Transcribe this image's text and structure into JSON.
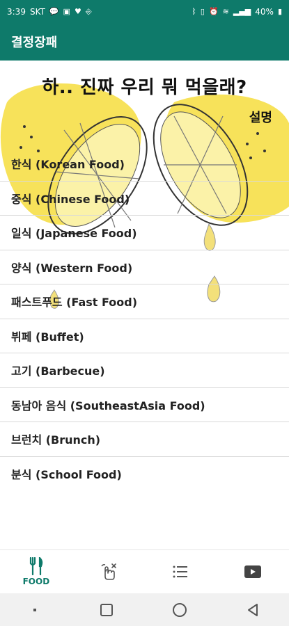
{
  "status_bar": {
    "time": "3:39",
    "carrier": "SKT",
    "battery": "40%",
    "icons": [
      "chat-icon",
      "gallery-icon",
      "heart-icon",
      "usb-icon",
      "bluetooth-icon",
      "vibrate-icon",
      "alarm-icon",
      "wifi-icon",
      "signal-icon",
      "battery-icon"
    ]
  },
  "app_bar": {
    "title": "결정장패"
  },
  "main": {
    "headline": "하.. 진짜 우리 뭐 먹을래?",
    "description_link": "설명",
    "food_categories": [
      "한식 (Korean Food)",
      "중식 (Chinese Food)",
      "일식 (Japanese Food)",
      "양식 (Western Food)",
      "패스트푸드 (Fast Food)",
      "뷔페 (Buffet)",
      "고기 (Barbecue)",
      "동남아 음식 (SoutheastAsia Food)",
      "브런치 (Brunch)",
      "분식 (School Food)"
    ]
  },
  "bottom_nav": {
    "items": [
      {
        "label": "FOOD",
        "icon": "fork-knife-icon",
        "active": true
      },
      {
        "label": "",
        "icon": "tap-gesture-icon",
        "active": false
      },
      {
        "label": "",
        "icon": "list-icon",
        "active": false
      },
      {
        "label": "",
        "icon": "youtube-icon",
        "active": false
      }
    ]
  },
  "colors": {
    "primary": "#0e7a6a",
    "lemon": "#f7e25a"
  }
}
